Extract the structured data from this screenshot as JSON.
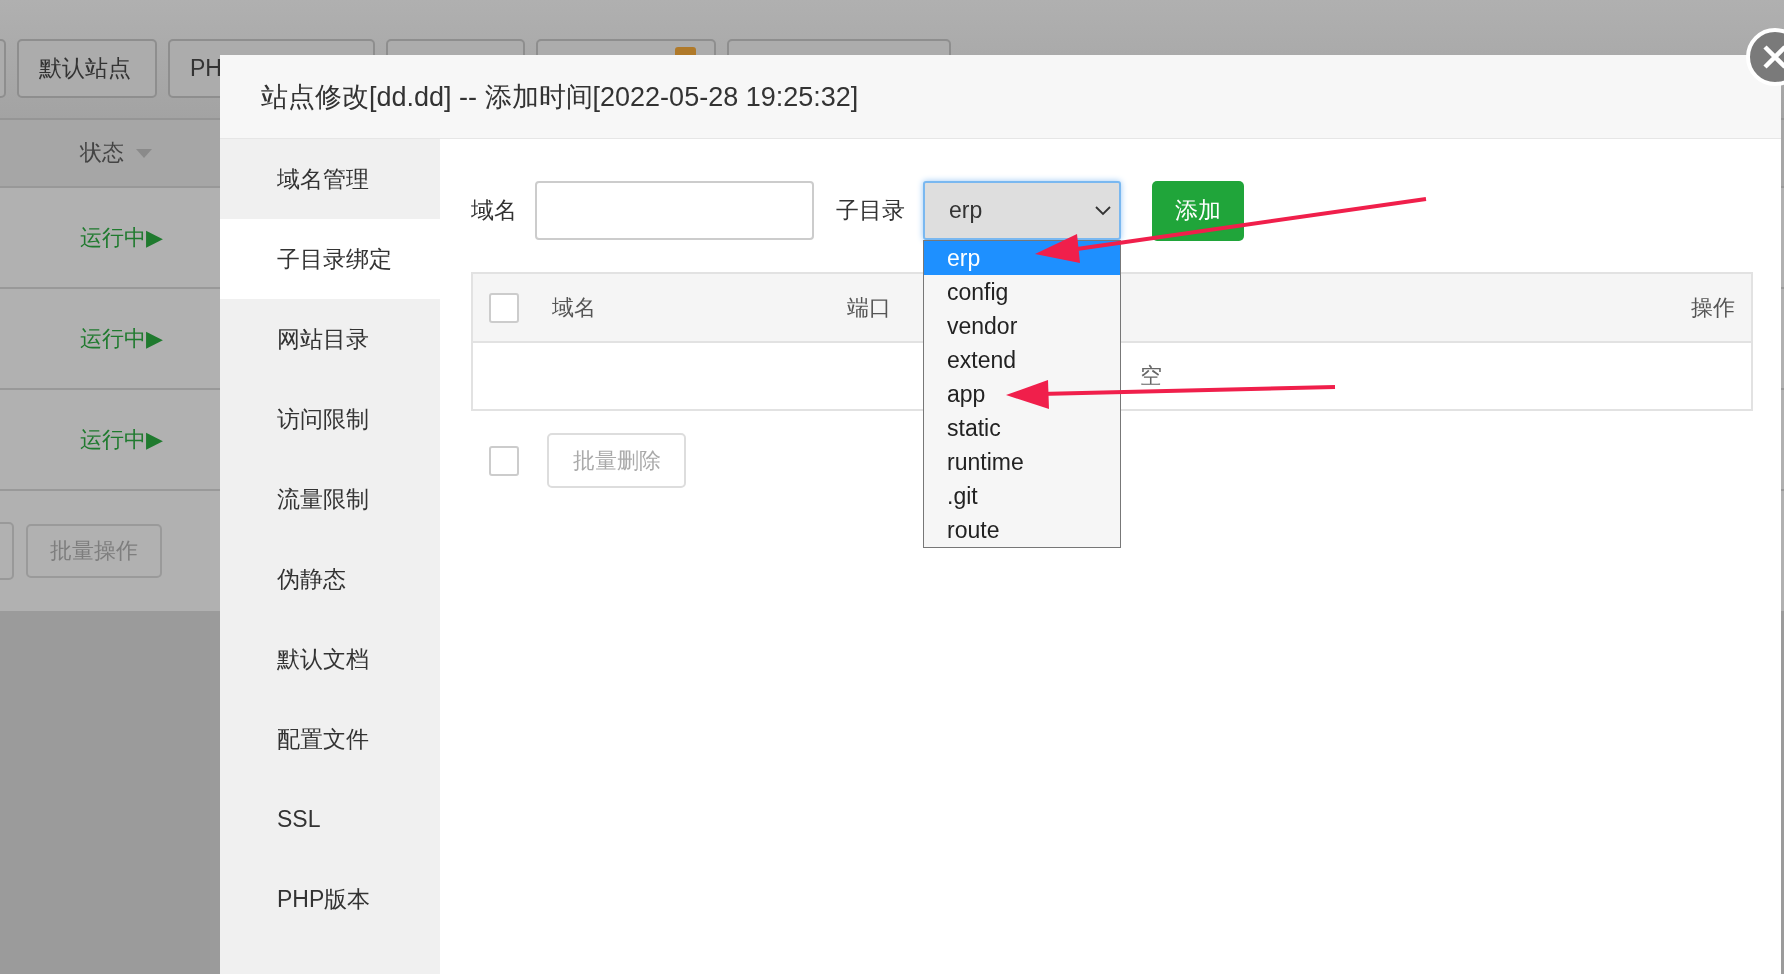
{
  "background_page": {
    "tabs": [
      {
        "label": "默认站点"
      },
      {
        "label": "PH"
      }
    ],
    "status_header": "状态",
    "rows": [
      {
        "status": "运行中▶"
      },
      {
        "status": "运行中▶"
      },
      {
        "status": "运行中▶"
      }
    ],
    "batch_button": "批量操作"
  },
  "dialog": {
    "title": "站点修改[dd.dd] -- 添加时间[2022-05-28 19:25:32]",
    "sidebar": [
      {
        "label": "域名管理",
        "selected": false
      },
      {
        "label": "子目录绑定",
        "selected": true
      },
      {
        "label": "网站目录",
        "selected": false
      },
      {
        "label": "访问限制",
        "selected": false
      },
      {
        "label": "流量限制",
        "selected": false
      },
      {
        "label": "伪静态",
        "selected": false
      },
      {
        "label": "默认文档",
        "selected": false
      },
      {
        "label": "配置文件",
        "selected": false
      },
      {
        "label": "SSL",
        "selected": false
      },
      {
        "label": "PHP版本",
        "selected": false
      }
    ],
    "form": {
      "domain_label": "域名",
      "subdir_label": "子目录",
      "select_value": "erp",
      "expanded": true,
      "add_button": "添加",
      "options": [
        {
          "label": "erp",
          "selected": true
        },
        {
          "label": "config",
          "selected": false
        },
        {
          "label": "vendor",
          "selected": false
        },
        {
          "label": "extend",
          "selected": false
        },
        {
          "label": "app",
          "selected": false
        },
        {
          "label": "static",
          "selected": false
        },
        {
          "label": "runtime",
          "selected": false
        },
        {
          "label": ".git",
          "selected": false
        },
        {
          "label": "route",
          "selected": false
        }
      ]
    },
    "table": {
      "header_checked": false,
      "columns": [
        "域名",
        "端口",
        "操作"
      ],
      "empty_text": "空"
    },
    "footer": {
      "checked": false,
      "delete_button": "批量删除"
    }
  }
}
